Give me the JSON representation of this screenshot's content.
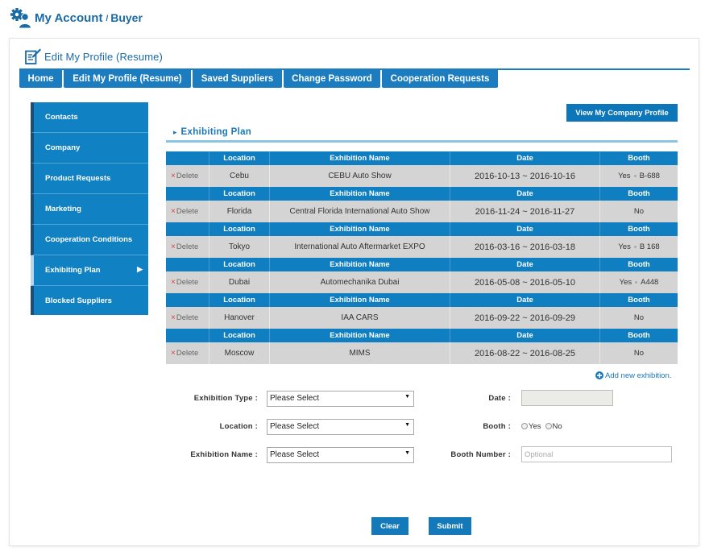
{
  "header": {
    "icon": "user-gear-icon",
    "title_main": "My Account",
    "title_sep": "/",
    "title_sub": "Buyer"
  },
  "panel": {
    "icon": "edit-profile-icon",
    "title": "Edit My Profile (Resume)"
  },
  "tabs": [
    "Home",
    "Edit My Profile (Resume)",
    "Saved Suppliers",
    "Change Password",
    "Cooperation Requests"
  ],
  "sidebar": {
    "items": [
      "Contacts",
      "Company",
      "Product Requests",
      "Marketing",
      "Cooperation Conditions",
      "Exhibiting Plan",
      "Blocked Suppliers"
    ],
    "active_index": 5,
    "active_marker_icon": "triangle-right-icon"
  },
  "view_profile_button": "View My Company Profile",
  "section": {
    "icon": "triangle-right-small-icon",
    "title": "Exhibiting Plan"
  },
  "table": {
    "headers": [
      "Location",
      "Exhibition Name",
      "Date",
      "Booth"
    ],
    "delete_label": "Delete",
    "delete_icon": "close-x-icon",
    "rows": [
      {
        "location": "Cebu",
        "name": "CEBU Auto Show",
        "date": "2016-10-13 ~ 2016-10-16",
        "booth": "Yes",
        "booth_number": "B-688"
      },
      {
        "location": "Florida",
        "name": "Central Florida International Auto Show",
        "date": "2016-11-24 ~ 2016-11-27",
        "booth": "No",
        "booth_number": ""
      },
      {
        "location": "Tokyo",
        "name": "International Auto Aftermarket EXPO",
        "date": "2016-03-16 ~ 2016-03-18",
        "booth": "Yes",
        "booth_number": "B 168"
      },
      {
        "location": "Dubai",
        "name": "Automechanika Dubai",
        "date": "2016-05-08 ~ 2016-05-10",
        "booth": "Yes",
        "booth_number": "A448"
      },
      {
        "location": "Hanover",
        "name": "IAA CARS",
        "date": "2016-09-22 ~ 2016-09-29",
        "booth": "No",
        "booth_number": ""
      },
      {
        "location": "Moscow",
        "name": "MIMS",
        "date": "2016-08-22 ~ 2016-08-25",
        "booth": "No",
        "booth_number": ""
      }
    ]
  },
  "add_new": {
    "icon": "plus-circle-icon",
    "label": "Add new exhibition."
  },
  "form": {
    "exhibition_type": {
      "label": "Exhibition Type :",
      "value": "Please Select"
    },
    "location": {
      "label": "Location :",
      "value": "Please Select"
    },
    "exhibition_name": {
      "label": "Exhibition Name :",
      "value": "Please Select"
    },
    "date": {
      "label": "Date :",
      "value": ""
    },
    "booth": {
      "label": "Booth :",
      "options": [
        "Yes",
        "No"
      ],
      "selected": null
    },
    "booth_number": {
      "label": "Booth Number :",
      "placeholder": "Optional",
      "value": ""
    }
  },
  "buttons": {
    "clear": "Clear",
    "submit": "Submit"
  },
  "colors": {
    "accent": "#1a7cbf",
    "table_header": "#0f7fc2",
    "title_blue": "#1a6aa5",
    "sidebar_border": "#1e4d72",
    "row_bg": "#d4d4d4",
    "delete_red": "#e0423a"
  }
}
